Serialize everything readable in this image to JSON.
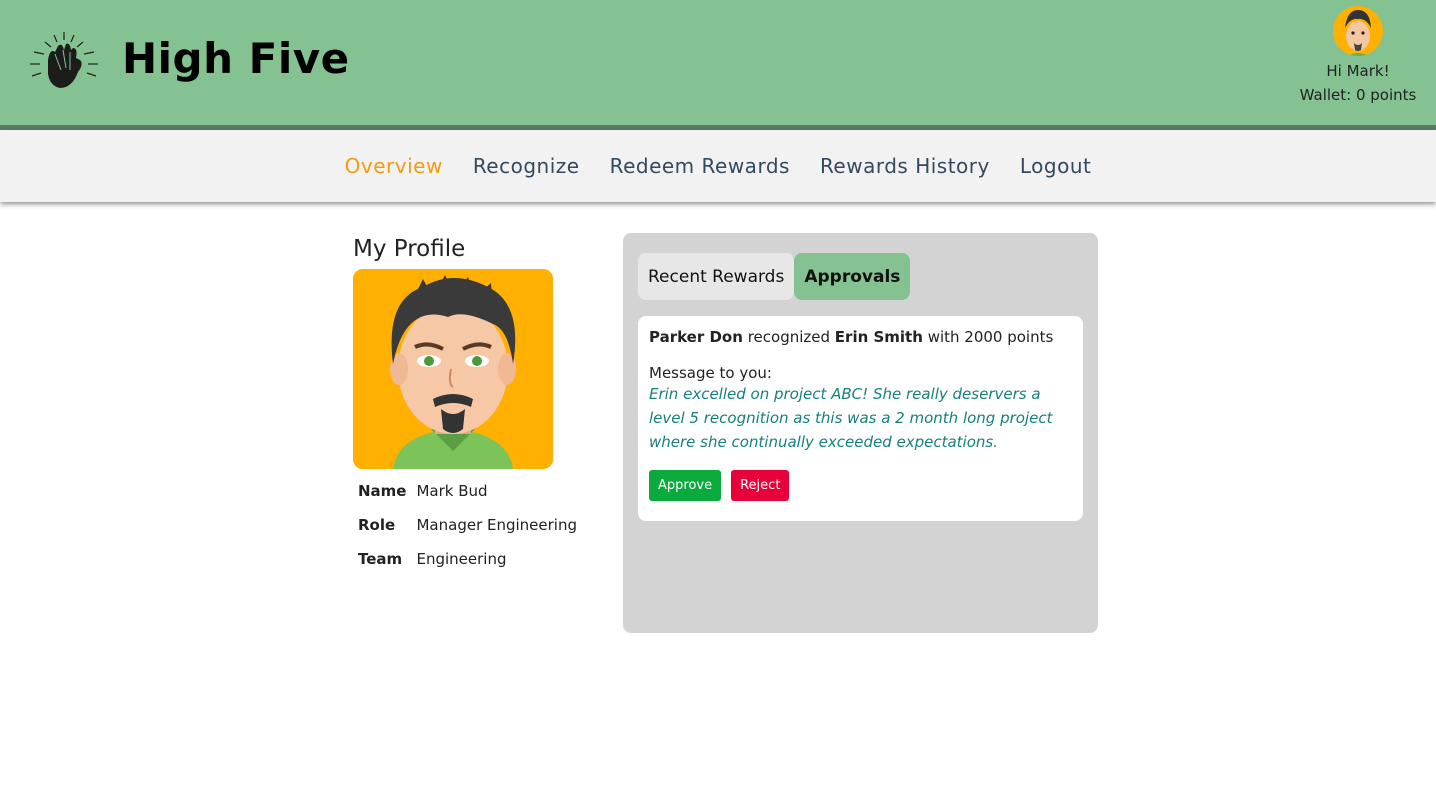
{
  "header": {
    "brand": "High Five",
    "greeting": "Hi Mark!",
    "wallet": "Wallet: 0 points"
  },
  "nav": {
    "items": [
      "Overview",
      "Recognize",
      "Redeem Rewards",
      "Rewards History",
      "Logout"
    ],
    "active": "Overview"
  },
  "profile": {
    "title": "My Profile",
    "rows": [
      {
        "label": "Name",
        "value": "Mark Bud"
      },
      {
        "label": "Role",
        "value": "Manager Engineering"
      },
      {
        "label": "Team",
        "value": "Engineering"
      }
    ]
  },
  "panel": {
    "tabs": [
      "Recent Rewards",
      "Approvals"
    ],
    "active_tab": "Approvals",
    "approval": {
      "giver": "Parker Don",
      "verb": "recognized",
      "receiver": "Erin Smith",
      "suffix": "with 2000 points",
      "message_label": "Message to you:",
      "message": "Erin excelled on project ABC! She really deservers a level 5 recognition as this was a 2 month long project where she continually exceeded expectations.",
      "approve_label": "Approve",
      "reject_label": "Reject"
    }
  },
  "colors": {
    "header_bg": "#84c391",
    "nav_active": "#f39c12",
    "approve": "#0aaa3c",
    "reject": "#e8003a"
  }
}
